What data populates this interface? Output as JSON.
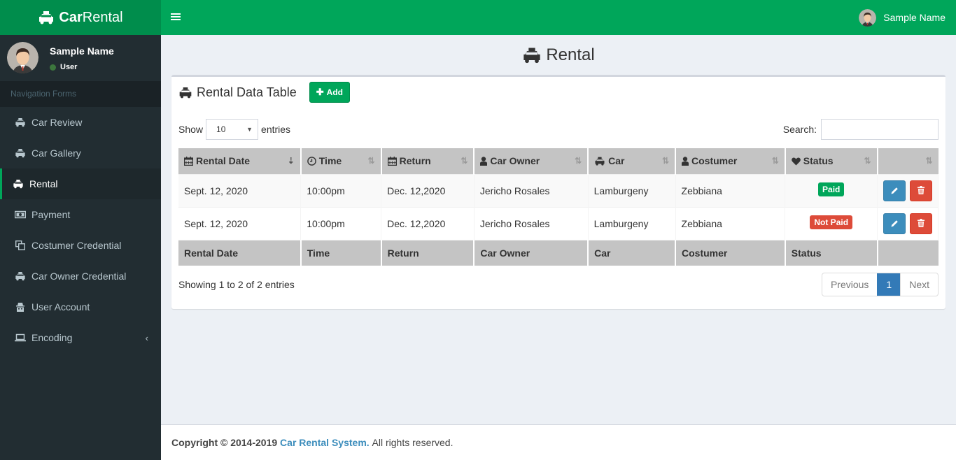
{
  "app": {
    "brand_bold": "Car",
    "brand_light": "Rental",
    "brand_color": "#00a65a",
    "brand_dark_color": "#008d4c"
  },
  "navbar": {
    "toggle_icon": "hamburger-icon",
    "user_name": "Sample Name"
  },
  "sidebar": {
    "user": {
      "name": "Sample Name",
      "role": "User",
      "status_color": "#3c763d"
    },
    "header": "Navigation Forms",
    "items": [
      {
        "label": "Car Review",
        "icon": "taxi-icon",
        "active": false
      },
      {
        "label": "Car Gallery",
        "icon": "taxi-icon",
        "active": false
      },
      {
        "label": "Rental",
        "icon": "taxi-icon",
        "active": true
      },
      {
        "label": "Payment",
        "icon": "money-icon",
        "active": false
      },
      {
        "label": "Costumer Credential",
        "icon": "clone-icon",
        "active": false
      },
      {
        "label": "Car Owner Credential",
        "icon": "taxi-icon",
        "active": false
      },
      {
        "label": "User Account",
        "icon": "user-secret-icon",
        "active": false
      },
      {
        "label": "Encoding",
        "icon": "laptop-icon",
        "active": false,
        "has_submenu": true
      }
    ]
  },
  "page": {
    "title": "Rental"
  },
  "box": {
    "title": "Rental Data Table",
    "add_label": "Add",
    "show_label": "Show",
    "entries_label": "entries",
    "page_length": "10",
    "search_label": "Search:",
    "search_value": "",
    "columns": [
      {
        "label": "Rental Date",
        "icon": "calendar-icon"
      },
      {
        "label": "Time",
        "icon": "clock-icon"
      },
      {
        "label": "Return",
        "icon": "calendar-icon"
      },
      {
        "label": "Car Owner",
        "icon": "user-icon"
      },
      {
        "label": "Car",
        "icon": "taxi-icon"
      },
      {
        "label": "Costumer",
        "icon": "user-icon"
      },
      {
        "label": "Status",
        "icon": "heart-icon"
      },
      {
        "label": "",
        "icon": ""
      }
    ],
    "rows": [
      {
        "rental_date": "Sept. 12, 2020",
        "time": "10:00pm",
        "return": "Dec. 12,2020",
        "car_owner": "Jericho Rosales",
        "car": "Lamburgeny",
        "costumer": "Zebbiana",
        "status": "Paid",
        "status_color": "#00a65a"
      },
      {
        "rental_date": "Sept. 12, 2020",
        "time": "10:00pm",
        "return": "Dec. 12,2020",
        "car_owner": "Jericho Rosales",
        "car": "Lamburgeny",
        "costumer": "Zebbiana",
        "status": "Not Paid",
        "status_color": "#dd4b39"
      }
    ],
    "footer_columns": [
      "Rental Date",
      "Time",
      "Return",
      "Car Owner",
      "Car",
      "Costumer",
      "Status",
      ""
    ],
    "info": "Showing 1 to 2 of 2 entries",
    "pagination": {
      "previous": "Previous",
      "current": "1",
      "next": "Next"
    }
  },
  "footer": {
    "copyright": "Copyright © 2014-2019",
    "link": "Car Rental System.",
    "suffix": "All rights reserved."
  }
}
